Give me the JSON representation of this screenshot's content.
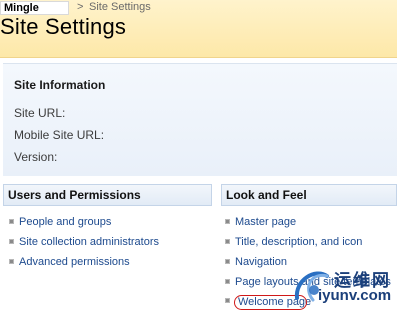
{
  "breadcrumb": {
    "site_name": "Mingle",
    "separator": ">",
    "current": "Site Settings"
  },
  "page_title": "Site Settings",
  "site_information": {
    "title": "Site Information",
    "rows": [
      "Site URL:",
      "Mobile Site URL:",
      "Version:"
    ]
  },
  "users_and_permissions": {
    "title": "Users and Permissions",
    "links": [
      "People and groups",
      "Site collection administrators",
      "Advanced permissions"
    ]
  },
  "look_and_feel": {
    "title": "Look and Feel",
    "links": [
      "Master page",
      "Title, description, and icon",
      "Navigation",
      "Page layouts and site templates",
      "Welcome page"
    ]
  },
  "watermark": {
    "text_cn": "运维网",
    "text_en": "iyunv.com"
  },
  "colors": {
    "link": "#1d4a8e",
    "highlight": "#d01818",
    "header_bg": "#fde8a8"
  }
}
